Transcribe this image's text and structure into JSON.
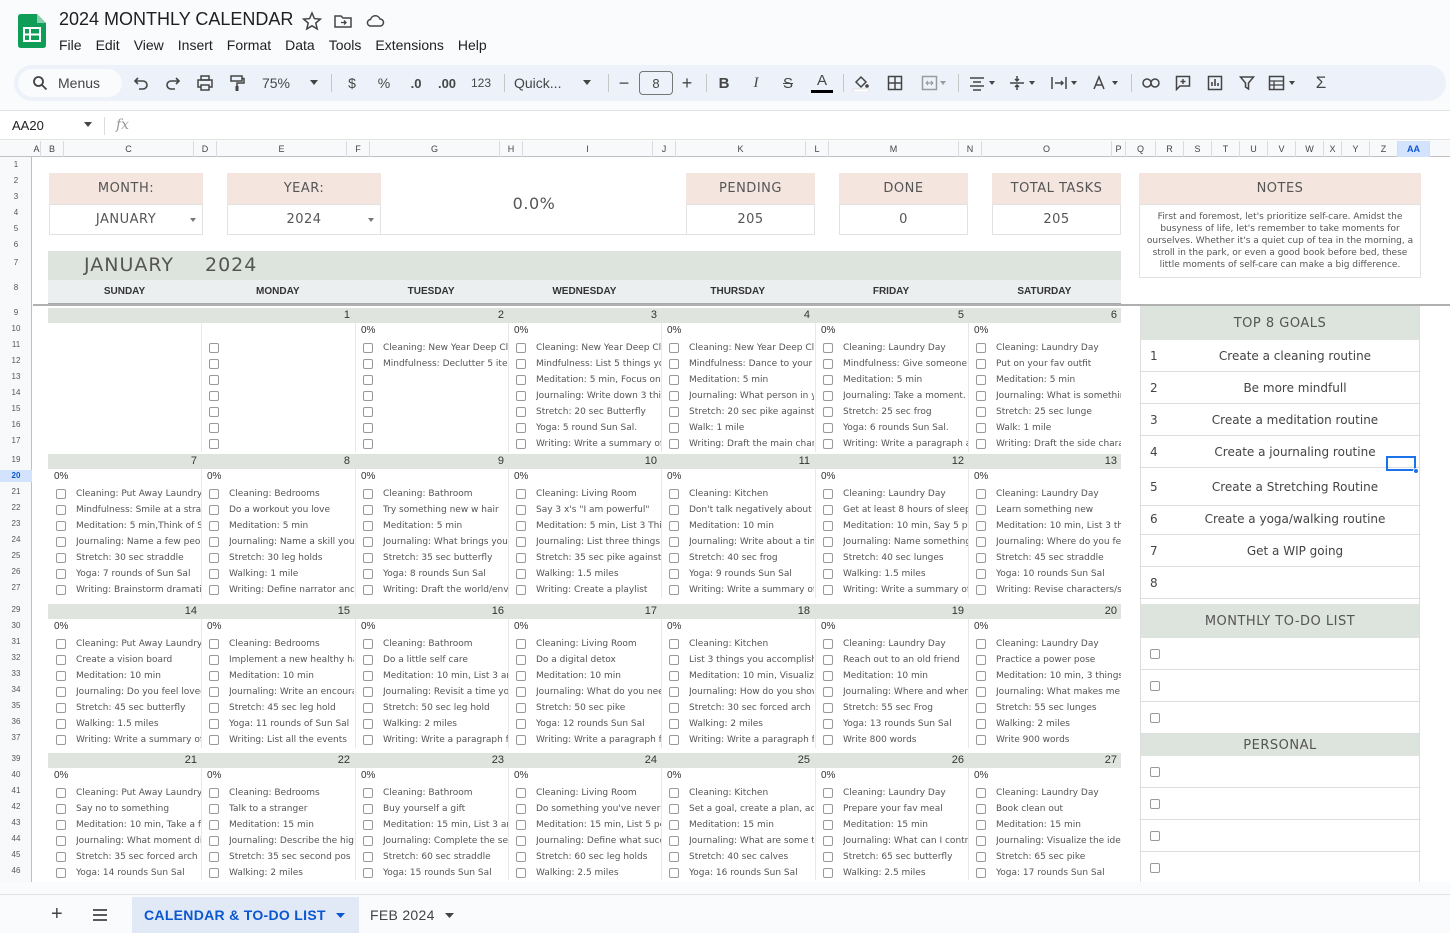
{
  "doc": {
    "title": "2024 MONTHLY CALENDAR"
  },
  "menu": [
    "File",
    "Edit",
    "View",
    "Insert",
    "Format",
    "Data",
    "Tools",
    "Extensions",
    "Help"
  ],
  "toolbar": {
    "menus_label": "Menus",
    "zoom": "75%",
    "currency": "$",
    "percent": "%",
    "dec_dec": ".0",
    "inc_dec": ".00",
    "format_123": "123",
    "font": "Quick...",
    "font_size": "8",
    "minus": "−",
    "plus": "+",
    "bold": "B",
    "italic": "I",
    "strike": "S",
    "text_color": "A"
  },
  "formula": {
    "cell_ref": "AA20",
    "fx": "fx"
  },
  "columns": [
    "A",
    "B",
    "C",
    "D",
    "E",
    "F",
    "G",
    "H",
    "I",
    "J",
    "K",
    "L",
    "M",
    "N",
    "O",
    "P",
    "Q",
    "R",
    "S",
    "T",
    "U",
    "V",
    "W",
    "X",
    "Y",
    "Z",
    "AA"
  ],
  "rows": [
    "1",
    "2",
    "3",
    "4",
    "5",
    "6",
    "7",
    "8",
    "9",
    "10",
    "11",
    "12",
    "13",
    "14",
    "15",
    "16",
    "17",
    "19",
    "20",
    "21",
    "22",
    "23",
    "24",
    "25",
    "26",
    "27",
    "29",
    "30",
    "31",
    "32",
    "33",
    "34",
    "35",
    "36",
    "37",
    "39",
    "40",
    "41",
    "42",
    "43",
    "44",
    "45",
    "46"
  ],
  "summary": {
    "month_label": "MONTH:",
    "month_value": "JANUARY",
    "year_label": "YEAR:",
    "year_value": "2024",
    "progress": "0.0%",
    "pending_label": "PENDING",
    "pending_value": "205",
    "done_label": "DONE",
    "done_value": "0",
    "total_label": "TOTAL TASKS",
    "total_value": "205",
    "notes_label": "NOTES",
    "notes_text": "First and foremost, let's prioritize self-care. Amidst the busyness of life, let's remember to take moments for ourselves. Whether it's a quiet cup of tea in the morning, a stroll in the park, or even a good book before bed, these little moments of self-care can make a big difference."
  },
  "calendar": {
    "month": "JANUARY",
    "year": "2024",
    "day_names": [
      "SUNDAY",
      "MONDAY",
      "TUESDAY",
      "WEDNESDAY",
      "THURSDAY",
      "FRIDAY",
      "SATURDAY"
    ],
    "weeks": [
      {
        "days": [
          {
            "num": "",
            "pct": "",
            "tasks": []
          },
          {
            "num": "1",
            "pct": "",
            "tasks": [
              "",
              "",
              "",
              "",
              "",
              "",
              ""
            ]
          },
          {
            "num": "2",
            "pct": "0%",
            "tasks": [
              "Cleaning: New Year Deep Clea",
              "Mindfulness: Declutter 5 items",
              "",
              "",
              "",
              "",
              ""
            ]
          },
          {
            "num": "3",
            "pct": "0%",
            "tasks": [
              "Cleaning: New Year Deep Clea",
              "Mindfulness: List 5 things you",
              "Meditation: 5 min, Focus on Br",
              "Journaling: Write down 3 thing",
              "Stretch: 20 sec Butterfly",
              "Yoga: 5 round Sun Sal.",
              "Writing: Write a summary of th"
            ]
          },
          {
            "num": "4",
            "pct": "0%",
            "tasks": [
              "Cleaning: New Year Deep Clea",
              "Mindfulness: Dance to your fa",
              "Meditation: 5 min",
              "Journaling: What person in yo",
              "Stretch: 20 sec pike against wa",
              "Walk: 1 mile",
              "Writing: Draft the main charac"
            ]
          },
          {
            "num": "5",
            "pct": "0%",
            "tasks": [
              "Cleaning: Laundry Day",
              "Mindfulness: Give someone a",
              "Meditation: 5 min",
              "Journaling: Take a moment. W",
              "Stretch: 25 sec frog",
              "Yoga: 6 rounds Sun Sal.",
              "Writing: Write a paragraph ab"
            ]
          },
          {
            "num": "6",
            "pct": "0%",
            "tasks": [
              "Cleaning: Laundry Day",
              "Put on your fav outfit",
              "Meditation: 5 min",
              "Journaling: What is something you",
              "Stretch: 25 sec lunge",
              "Walk: 1 mile",
              "Writing: Draft the side characters"
            ]
          }
        ]
      },
      {
        "days": [
          {
            "num": "7",
            "pct": "0%",
            "tasks": [
              "Cleaning: Put Away Laundry",
              "Mindfulness: Smile at a strang",
              "Meditation: 5 min,Think of Sor",
              "Journaling: Name a few peopl",
              "Stretch: 30 sec straddle",
              "Yoga: 7 rounds of Sun Sal",
              "Writing: Brainstorm dramatic e"
            ]
          },
          {
            "num": "8",
            "pct": "0%",
            "tasks": [
              "Cleaning: Bedrooms",
              "Do a workout you love",
              "Meditation: 5 min",
              "Journaling: Name a skill you're",
              "Stretch: 30 leg holds",
              "Walking: 1 mile",
              "Writing: Define narrator and te"
            ]
          },
          {
            "num": "9",
            "pct": "0%",
            "tasks": [
              "Cleaning: Bathroom",
              "Try something new w hair",
              "Meditation: 5 min",
              "Journaling: What brings you jo",
              "Stretch: 35 sec butterfly",
              "Yoga: 8 rounds Sun Sal",
              "Writing: Draft the world/enviro"
            ]
          },
          {
            "num": "10",
            "pct": "0%",
            "tasks": [
              "Cleaning: Living Room",
              "Say 3 x's \"I am powerful\"",
              "Meditation: 5 min, List 3 Things",
              "Journaling: List three things yo",
              "Stretch: 35 sec pike against wa",
              "Walking: 1.5 miles",
              "Writing: Create a playlist"
            ]
          },
          {
            "num": "11",
            "pct": "0%",
            "tasks": [
              "Cleaning: Kitchen",
              "Don't talk negatively about pe",
              "Meditation: 10 min",
              "Journaling: Write about a time",
              "Stretch: 40 sec frog",
              "Yoga: 9 rounds Sun Sal",
              "Writing: Write a summary of A"
            ]
          },
          {
            "num": "12",
            "pct": "0%",
            "tasks": [
              "Cleaning: Laundry Day",
              "Get at least 8 hours of sleep",
              "Meditation: 10 min, Say 5 posit",
              "Journaling: Name something y",
              "Stretch: 40 sec lunges",
              "Walking: 1.5 miles",
              "Writing: Write a summary of A"
            ]
          },
          {
            "num": "13",
            "pct": "0%",
            "tasks": [
              "Cleaning: Laundry Day",
              "Learn something new",
              "Meditation: 10 min, List 3 things you",
              "Journaling: Where do you feel mos",
              "Stretch: 45 sec straddle",
              "Yoga: 10 rounds Sun Sal",
              "Writing: Revise characters/settings"
            ]
          }
        ]
      },
      {
        "days": [
          {
            "num": "14",
            "pct": "0%",
            "tasks": [
              "Cleaning: Put Away Laundry",
              "Create a vision board",
              "Meditation: 10 min",
              "Journaling: Do you feel loved?",
              "Stretch: 45 sec butterfly",
              "Walking: 1.5 miles",
              "Writing: Write a summary of A"
            ]
          },
          {
            "num": "15",
            "pct": "0%",
            "tasks": [
              "Cleaning: Bedrooms",
              "Implement a new healthy habi",
              "Meditation: 10 min",
              "Journaling: Write an encourag",
              "Stretch: 45 sec leg hold",
              "Yoga: 11 rounds of Sun Sal",
              "Writing: List all the events"
            ]
          },
          {
            "num": "16",
            "pct": "0%",
            "tasks": [
              "Cleaning: Bathroom",
              "Do a little self care",
              "Meditation: 10 min, List 3 amaz",
              "Journaling: Revisit a time you",
              "Stretch: 50 sec leg hold",
              "Walking: 2 miles",
              "Writing: Write a paragraph for"
            ]
          },
          {
            "num": "17",
            "pct": "0%",
            "tasks": [
              "Cleaning: Living Room",
              "Do a digital detox",
              "Meditation: 10 min",
              "Journaling: What do you need",
              "Stretch: 50 sec pike",
              "Yoga: 12 rounds Sun Sal",
              "Writing: Write a paragraph for"
            ]
          },
          {
            "num": "18",
            "pct": "0%",
            "tasks": [
              "Cleaning: Kitchen",
              "List 3 things you accomplished",
              "Meditation: 10 min, Visualize a",
              "Journaling: How do you show",
              "Stretch: 30 sec forced arch",
              "Walking: 2 miles",
              "Writing: Write a paragraph for"
            ]
          },
          {
            "num": "19",
            "pct": "0%",
            "tasks": [
              "Cleaning: Laundry Day",
              "Reach out to an old friend",
              "Meditation: 10 min",
              "Journaling: Where and when d",
              "Stretch: 55 sec Frog",
              "Yoga: 13 rounds Sun Sal",
              "Write 800 words"
            ]
          },
          {
            "num": "20",
            "pct": "0%",
            "tasks": [
              "Cleaning: Laundry Day",
              "Practice a power pose",
              "Meditation: 10 min, 3 things you are",
              "Journaling: What makes me guard",
              "Stretch: 55 sec lunges",
              "Walking: 2 miles",
              "Write 900 words"
            ]
          }
        ]
      },
      {
        "days": [
          {
            "num": "21",
            "pct": "0%",
            "tasks": [
              "Cleaning: Put Away Laundry",
              "Say no to something",
              "Meditation: 10 min, Take a few",
              "Journaling: What moment did",
              "Stretch: 35 sec forced arch",
              "Yoga: 14 rounds Sun Sal"
            ]
          },
          {
            "num": "22",
            "pct": "0%",
            "tasks": [
              "Cleaning: Bedrooms",
              "Talk to a stranger",
              "Meditation: 15 min",
              "Journaling: Describe the highe",
              "Stretch: 35 sec second pos",
              "Walking: 2 miles"
            ]
          },
          {
            "num": "23",
            "pct": "0%",
            "tasks": [
              "Cleaning: Bathroom",
              "Buy yourself a gift",
              "Meditation: 15 min, List 3 amaz",
              "Journaling: Complete the sent",
              "Stretch: 60 sec straddle",
              "Yoga: 15 rounds Sun Sal"
            ]
          },
          {
            "num": "24",
            "pct": "0%",
            "tasks": [
              "Cleaning: Living Room",
              "Do something you've never do",
              "Meditation: 15 min, List 5 perso",
              "Journaling: Define what succe",
              "Stretch: 60 sec leg holds",
              "Walking: 2.5 miles"
            ]
          },
          {
            "num": "25",
            "pct": "0%",
            "tasks": [
              "Cleaning: Kitchen",
              "Set a goal, create a plan, acco",
              "Meditation: 15 min",
              "Journaling: What are some thi",
              "Stretch: 40 sec calves",
              "Yoga: 16 rounds Sun Sal"
            ]
          },
          {
            "num": "26",
            "pct": "0%",
            "tasks": [
              "Cleaning: Laundry Day",
              "Prepare your fav meal",
              "Meditation: 15 min",
              "Journaling: What can I control",
              "Stretch: 65 sec butterfly",
              "Walking: 2.5 miles"
            ]
          },
          {
            "num": "27",
            "pct": "0%",
            "tasks": [
              "Cleaning: Laundry Day",
              "Book clean out",
              "Meditation: 15 min",
              "Journaling: Visualize the ideal life y",
              "Stretch: 65 sec pike",
              "Yoga: 17 rounds Sun Sal"
            ]
          }
        ]
      }
    ]
  },
  "goals": {
    "title": "TOP 8 GOALS",
    "items": [
      {
        "n": "1",
        "text": "Create a cleaning routine"
      },
      {
        "n": "2",
        "text": "Be more mindfull"
      },
      {
        "n": "3",
        "text": "Create a meditation routine"
      },
      {
        "n": "4",
        "text": "Create a journaling routine"
      },
      {
        "n": "5",
        "text": "Create a Stretching Routine"
      },
      {
        "n": "6",
        "text": "Create a yoga/walking routine"
      },
      {
        "n": "7",
        "text": "Get a WIP going"
      },
      {
        "n": "8",
        "text": ""
      }
    ]
  },
  "todo": {
    "title": "MONTHLY TO-DO LIST"
  },
  "personal": {
    "title": "PERSONAL"
  },
  "tabs": {
    "active": "CALENDAR & TO-DO LIST",
    "other": "FEB 2024"
  },
  "colors": {
    "accent": "#0b57d0",
    "header_pink": "#f4e6df",
    "header_green": "#dde3dd",
    "sheets_green": "#0f9d58"
  }
}
